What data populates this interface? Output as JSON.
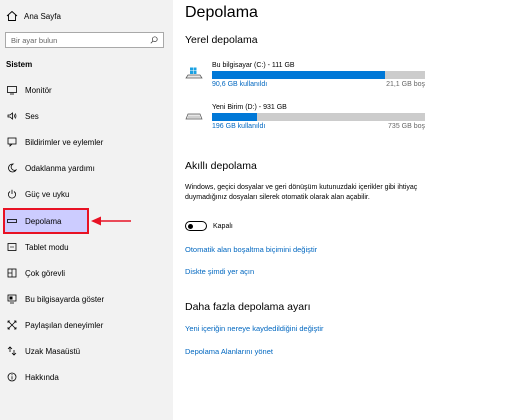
{
  "sidebar": {
    "home_label": "Ana Sayfa",
    "search_placeholder": "Bir ayar bulun",
    "section_title": "Sistem",
    "items": [
      {
        "label": "Monitör",
        "icon": "monitor-icon"
      },
      {
        "label": "Ses",
        "icon": "speaker-icon"
      },
      {
        "label": "Bildirimler ve eylemler",
        "icon": "notification-icon"
      },
      {
        "label": "Odaklanma yardımı",
        "icon": "moon-icon"
      },
      {
        "label": "Güç ve uyku",
        "icon": "power-icon"
      },
      {
        "label": "Depolama",
        "icon": "storage-icon",
        "active": true
      },
      {
        "label": "Tablet modu",
        "icon": "tablet-icon"
      },
      {
        "label": "Çok görevli",
        "icon": "multitask-icon"
      },
      {
        "label": "Bu bilgisayarda göster",
        "icon": "project-icon"
      },
      {
        "label": "Paylaşılan deneyimler",
        "icon": "shared-icon"
      },
      {
        "label": "Uzak Masaüstü",
        "icon": "remote-desktop-icon"
      },
      {
        "label": "Hakkında",
        "icon": "info-icon"
      }
    ],
    "highlight_color": "#e81224"
  },
  "main": {
    "title": "Depolama",
    "local_storage": {
      "heading": "Yerel depolama",
      "drives": [
        {
          "name": "Bu bilgisayar (C:) - 111 GB",
          "used": "90,6 GB kullanıldı",
          "free": "21,1 GB boş",
          "used_fraction": 0.81,
          "icon": "windows-drive-icon"
        },
        {
          "name": "Yeni Birim (D:) - 931 GB",
          "used": "196 GB kullanıldı",
          "free": "735 GB boş",
          "used_fraction": 0.21,
          "icon": "drive-icon"
        }
      ]
    },
    "smart_storage": {
      "heading": "Akıllı depolama",
      "description": "Windows, geçici dosyalar ve geri dönüşüm kutunuzdaki içerikler gibi ihtiyaç duymadığınız dosyaları silerek otomatik olarak alan açabilir.",
      "toggle_label": "Kapalı",
      "toggle_on": false,
      "link_configure": "Otomatik alan boşaltma biçimini değiştir",
      "link_free_now": "Diskte şimdi yer açın"
    },
    "more_settings": {
      "heading": "Daha fazla depolama ayarı",
      "link_save_location": "Yeni içeriğin nereye kaydedildiğini değiştir",
      "link_manage_spaces": "Depolama Alanlarını yönet"
    },
    "accent_color": "#0078d7"
  }
}
